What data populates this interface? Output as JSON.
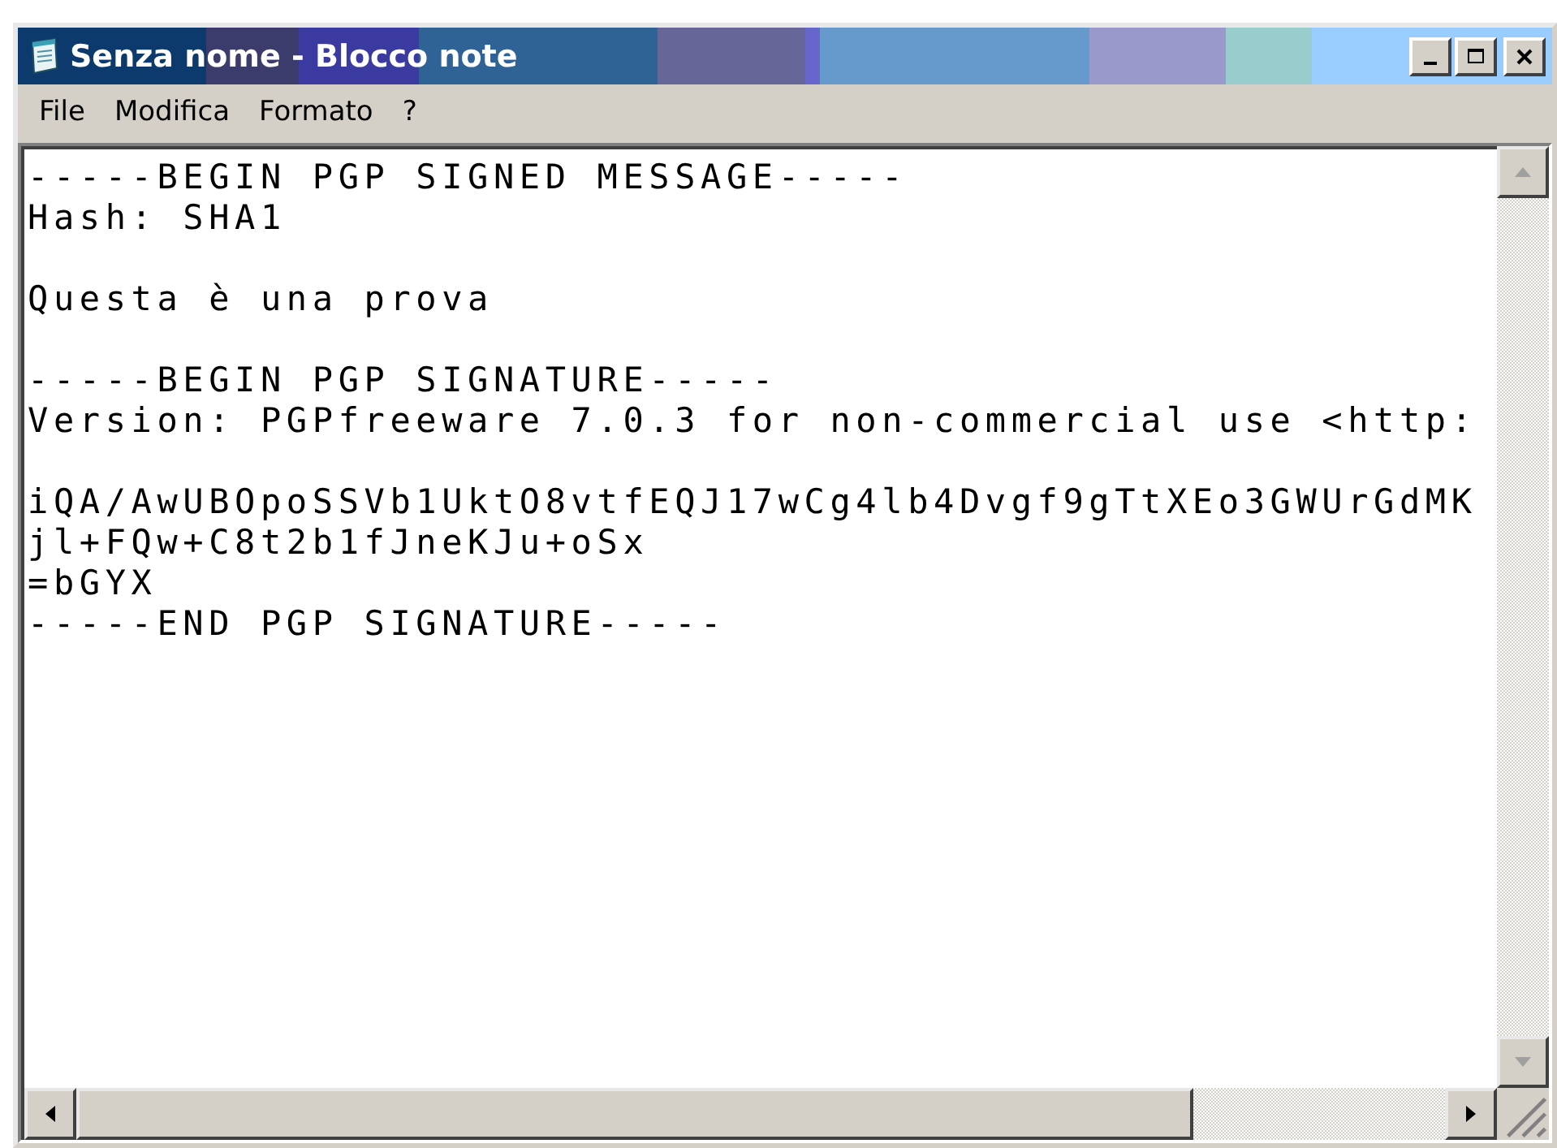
{
  "window": {
    "title": "Senza nome - Blocco note"
  },
  "menu": [
    {
      "label": "File"
    },
    {
      "label": "Modifica"
    },
    {
      "label": "Formato"
    },
    {
      "label": "?"
    }
  ],
  "document": {
    "blocks": [
      [
        "-----BEGIN PGP SIGNED MESSAGE-----",
        "Hash: SHA1"
      ],
      [
        "Questa è una prova"
      ],
      [
        "-----BEGIN PGP SIGNATURE-----",
        "Version: PGPfreeware 7.0.3 for non-commercial use <http:"
      ],
      [
        "iQA/AwUBOpoSSVb1UktO8vtfEQJ17wCg4lb4Dvgf9gTtXEo3GWUrGdMK",
        "jl+FQw+C8t2b1fJneKJu+oSx",
        "=bGYX",
        "-----END PGP SIGNATURE-----"
      ]
    ]
  }
}
